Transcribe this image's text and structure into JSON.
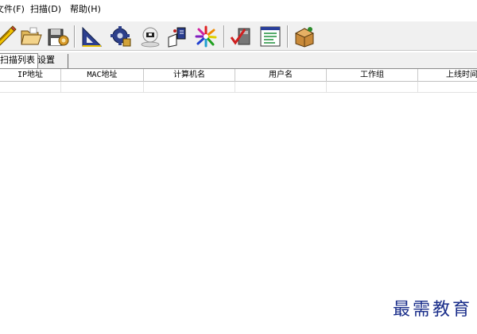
{
  "menu": {
    "file": "文件(F)",
    "scan": "扫描(D)",
    "help": "帮助(H)"
  },
  "toolbar": {
    "buttons": [
      {
        "name": "edit-pencil-icon"
      },
      {
        "name": "open-folder-icon"
      },
      {
        "name": "save-floppy-icon"
      },
      {
        "name": "triangle-ruler-icon"
      },
      {
        "name": "gear-screw-icon"
      },
      {
        "name": "webcam-icon"
      },
      {
        "name": "network-book-icon"
      },
      {
        "name": "color-burst-icon"
      },
      {
        "name": "check-tool-icon"
      },
      {
        "name": "report-window-icon"
      },
      {
        "name": "package-box-icon"
      }
    ]
  },
  "tabs": {
    "scan_list": "扫描列表",
    "settings": "设置"
  },
  "table": {
    "columns": [
      "IP地址",
      "MAC地址",
      "计算机名",
      "用户名",
      "工作组",
      "上线时间"
    ]
  },
  "watermark": "最需教育"
}
